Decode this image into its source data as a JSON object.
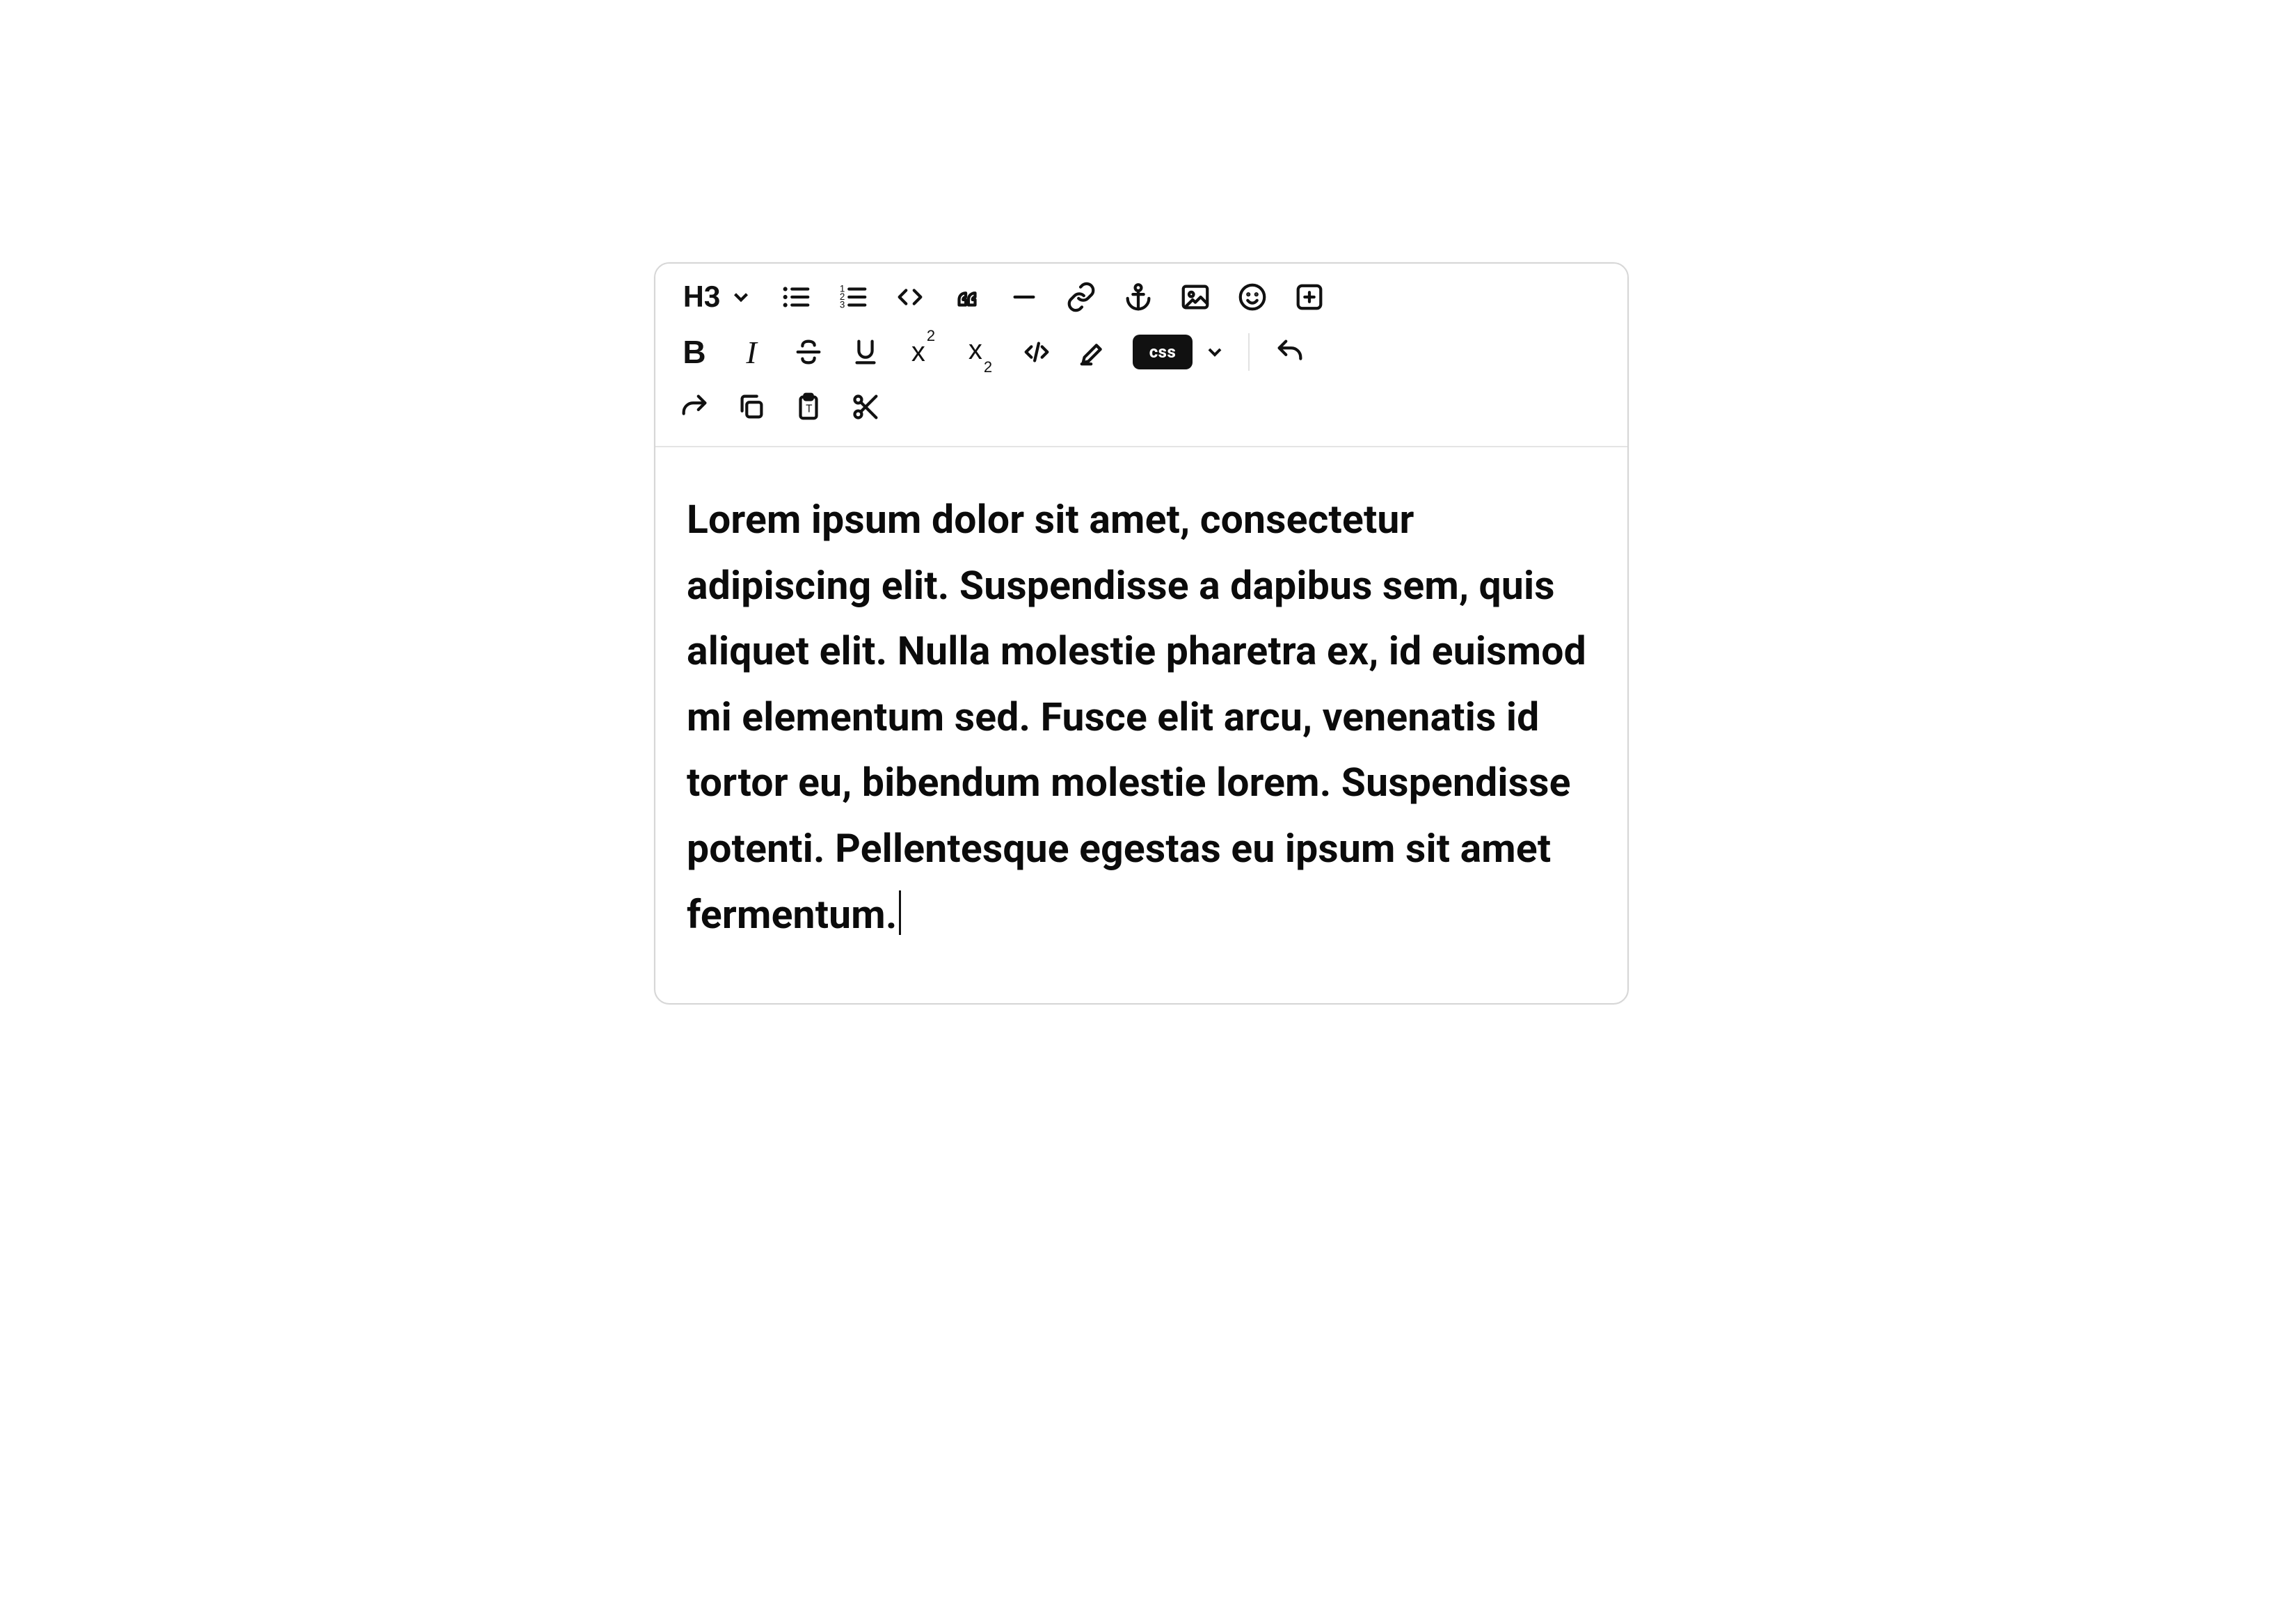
{
  "toolbar": {
    "heading_selector": {
      "label": "H3"
    },
    "css_badge": "css"
  },
  "editor": {
    "content": "Lorem ipsum dolor sit amet, consectetur adipiscing elit. Suspendisse a dapibus sem, quis aliquet elit. Nulla molestie pharetra ex, id euismod mi elementum sed. Fusce elit arcu, venenatis id tortor eu, bibendum molestie lorem. Suspendisse potenti. Pellentesque egestas eu ipsum sit amet fermentum."
  }
}
